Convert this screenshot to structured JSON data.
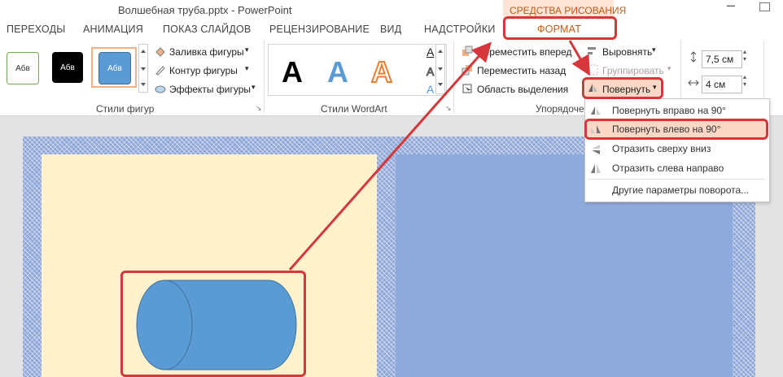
{
  "window": {
    "title": "Волшебная труба.pptx - PowerPoint",
    "contextual_group": "СРЕДСТВА РИСОВАНИЯ",
    "minimize_glyph": "–"
  },
  "tabs": [
    "ПЕРЕХОДЫ",
    "АНИМАЦИЯ",
    "ПОКАЗ СЛАЙДОВ",
    "РЕЦЕНЗИРОВАНИЕ",
    "ВИД",
    "НАДСТРОЙКИ",
    "ФОРМАТ"
  ],
  "shape_styles": {
    "swatches": [
      "Абв",
      "Абв",
      "Абв"
    ],
    "fill": "Заливка фигуры",
    "outline": "Контур фигуры",
    "effects": "Эффекты фигуры",
    "group_label": "Стили фигур"
  },
  "wordart": {
    "letters": [
      "A",
      "A",
      "A"
    ],
    "group_label": "Стили WordArt",
    "text_fill_letter": "A",
    "text_outline_letter": "A",
    "text_effects_letter": "A"
  },
  "arrange": {
    "bring_forward": "Переместить вперед",
    "send_backward": "Переместить назад",
    "selection_pane": "Область выделения",
    "align": "Выровнять",
    "group": "Группировать",
    "rotate": "Повернуть",
    "group_label": "Упорядоче"
  },
  "size": {
    "height": "7,5 см",
    "width": "4 см"
  },
  "rotate_menu": {
    "items": [
      "Повернуть вправо на 90°",
      "Повернуть влево на 90°",
      "Отразить сверху вниз",
      "Отразить слева направо"
    ],
    "more": "Другие параметры поворота..."
  },
  "colors": {
    "accent_red": "#d6373a",
    "contextual_orange": "#c55a11",
    "cylinder_blue": "#5b9bd5",
    "panel_yellow": "#fff2cc",
    "panel_blue": "#8faadc"
  }
}
